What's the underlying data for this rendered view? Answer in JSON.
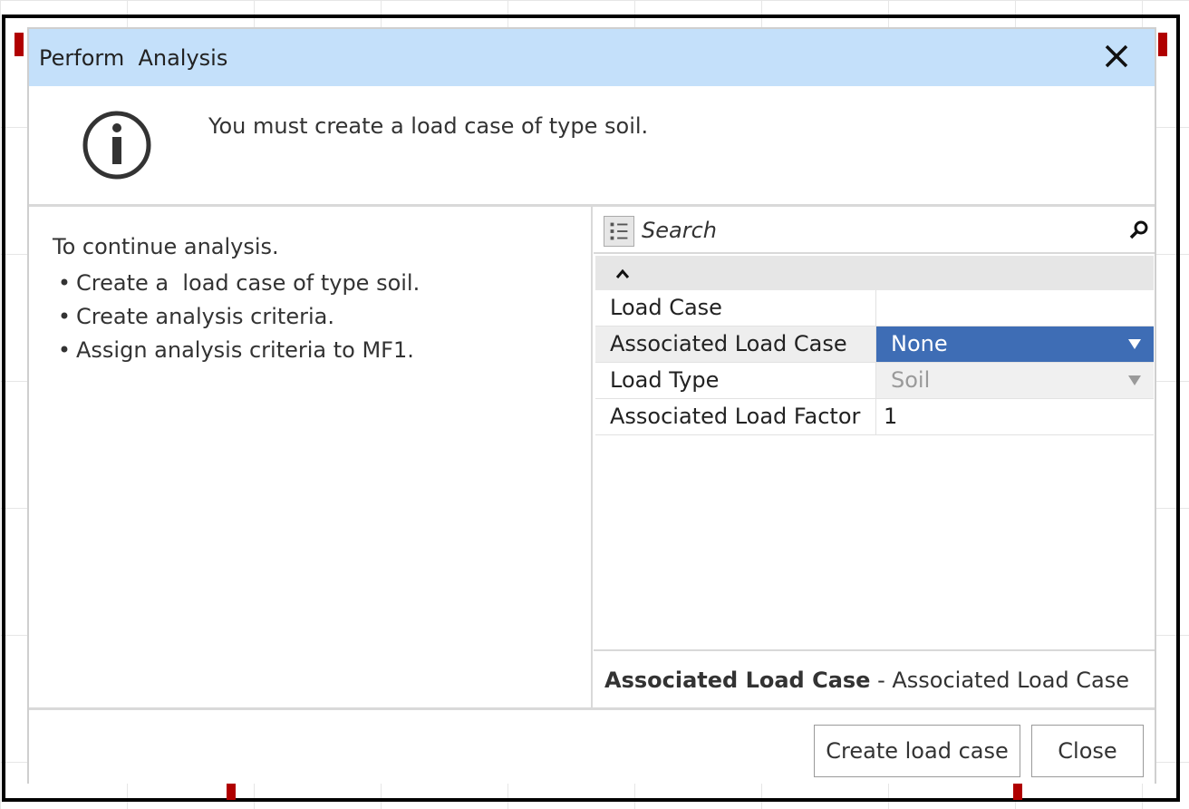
{
  "dialog": {
    "title": "Perform  Analysis",
    "message": "You must create a load case of type soil."
  },
  "instructions": {
    "heading": "To continue analysis.",
    "items": [
      "Create a  load case of type soil.",
      "Create analysis criteria.",
      "Assign analysis criteria to MF1."
    ]
  },
  "property_grid": {
    "search_placeholder": "Search",
    "rows": [
      {
        "name": "Load Case",
        "value": ""
      },
      {
        "name": "Associated Load Case",
        "value": "None"
      },
      {
        "name": "Load Type",
        "value": "Soil"
      },
      {
        "name": "Associated Load Factor",
        "value": "1"
      }
    ],
    "help": {
      "name": "Associated Load Case",
      "separator": " - ",
      "description": "Associated Load Case"
    }
  },
  "buttons": {
    "create_load_case": "Create load case",
    "close": "Close"
  },
  "colors": {
    "titlebar": "#c4e0fa",
    "selection": "#3e6db5"
  }
}
